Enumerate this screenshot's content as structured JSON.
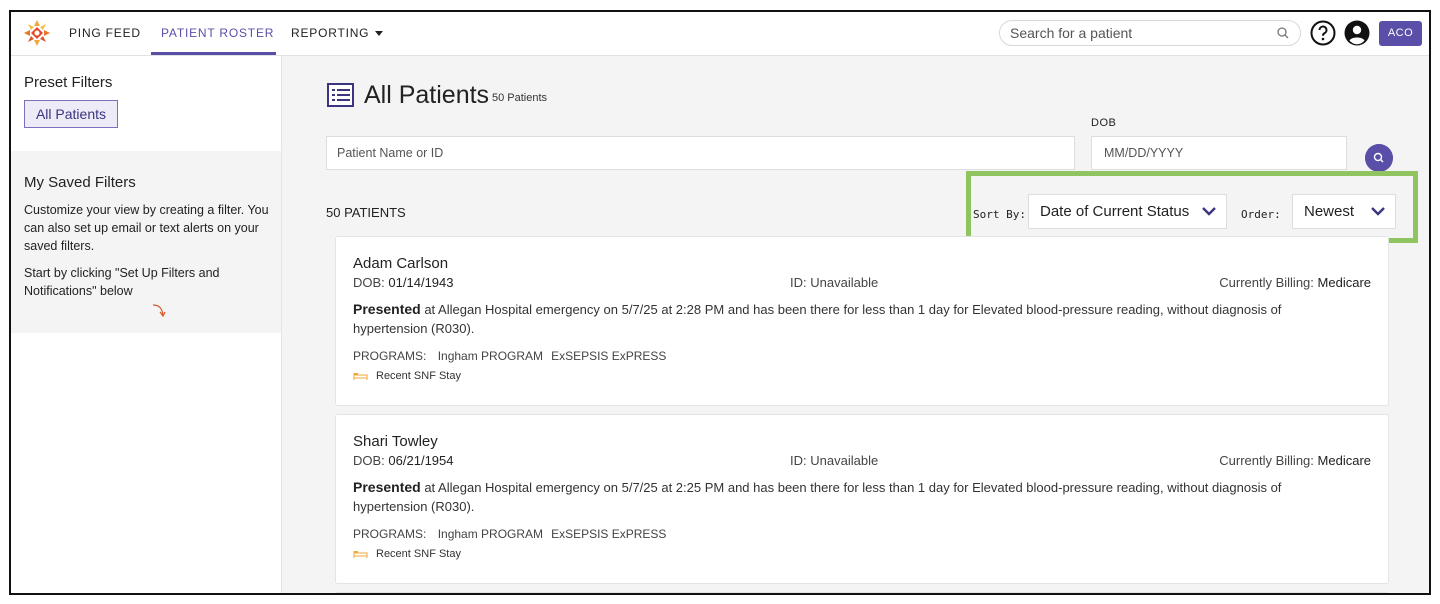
{
  "nav": {
    "items": [
      {
        "label": "PING FEED"
      },
      {
        "label": "PATIENT ROSTER",
        "active": true
      },
      {
        "label": "REPORTING"
      }
    ],
    "search_placeholder": "Search for a patient",
    "aco_label": "ACO",
    "accent_color": "#5a4fa8"
  },
  "sidebar": {
    "preset_title": "Preset Filters",
    "preset_button": "All Patients",
    "saved_title": "My Saved Filters",
    "saved_desc": "Customize your view by creating a filter. You can also set up email or text alerts on your saved filters.",
    "saved_hint": "Start by clicking \"Set Up Filters and Notifications\" below"
  },
  "main": {
    "title": "All Patients",
    "subtitle": "50 Patients",
    "name_placeholder": "Patient Name or ID",
    "dob_label": "DOB",
    "dob_placeholder": "MM/DD/YYYY",
    "count_label": "50 PATIENTS",
    "sort_by_label": "Sort By:",
    "sort_by_value": "Date of Current Status",
    "order_label": "Order:",
    "order_value": "Newest",
    "highlight_color": "#8fc460"
  },
  "patients": [
    {
      "name": "Adam Carlson",
      "dob_label": "DOB:",
      "dob": "01/14/1943",
      "id_label": "ID:",
      "id": "Unavailable",
      "billing_label": "Currently Billing:",
      "billing": "Medicare",
      "status": "Presented",
      "description": " at Allegan Hospital emergency on 5/7/25 at 2:28 PM and has been there for less than 1 day for Elevated blood-pressure reading, without diagnosis of hypertension (R030).",
      "programs_label": "PROGRAMS:",
      "programs": [
        "Ingham PROGRAM",
        "ExSEPSIS ExPRESS"
      ],
      "tag": "Recent SNF Stay"
    },
    {
      "name": "Shari Towley",
      "dob_label": "DOB:",
      "dob": "06/21/1954",
      "id_label": "ID:",
      "id": "Unavailable",
      "billing_label": "Currently Billing:",
      "billing": "Medicare",
      "status": "Presented",
      "description": " at Allegan Hospital emergency on 5/7/25 at 2:25 PM and has been there for less than 1 day for Elevated blood-pressure reading, without diagnosis of hypertension (R030).",
      "programs_label": "PROGRAMS:",
      "programs": [
        "Ingham PROGRAM",
        "ExSEPSIS ExPRESS"
      ],
      "tag": "Recent SNF Stay"
    }
  ]
}
